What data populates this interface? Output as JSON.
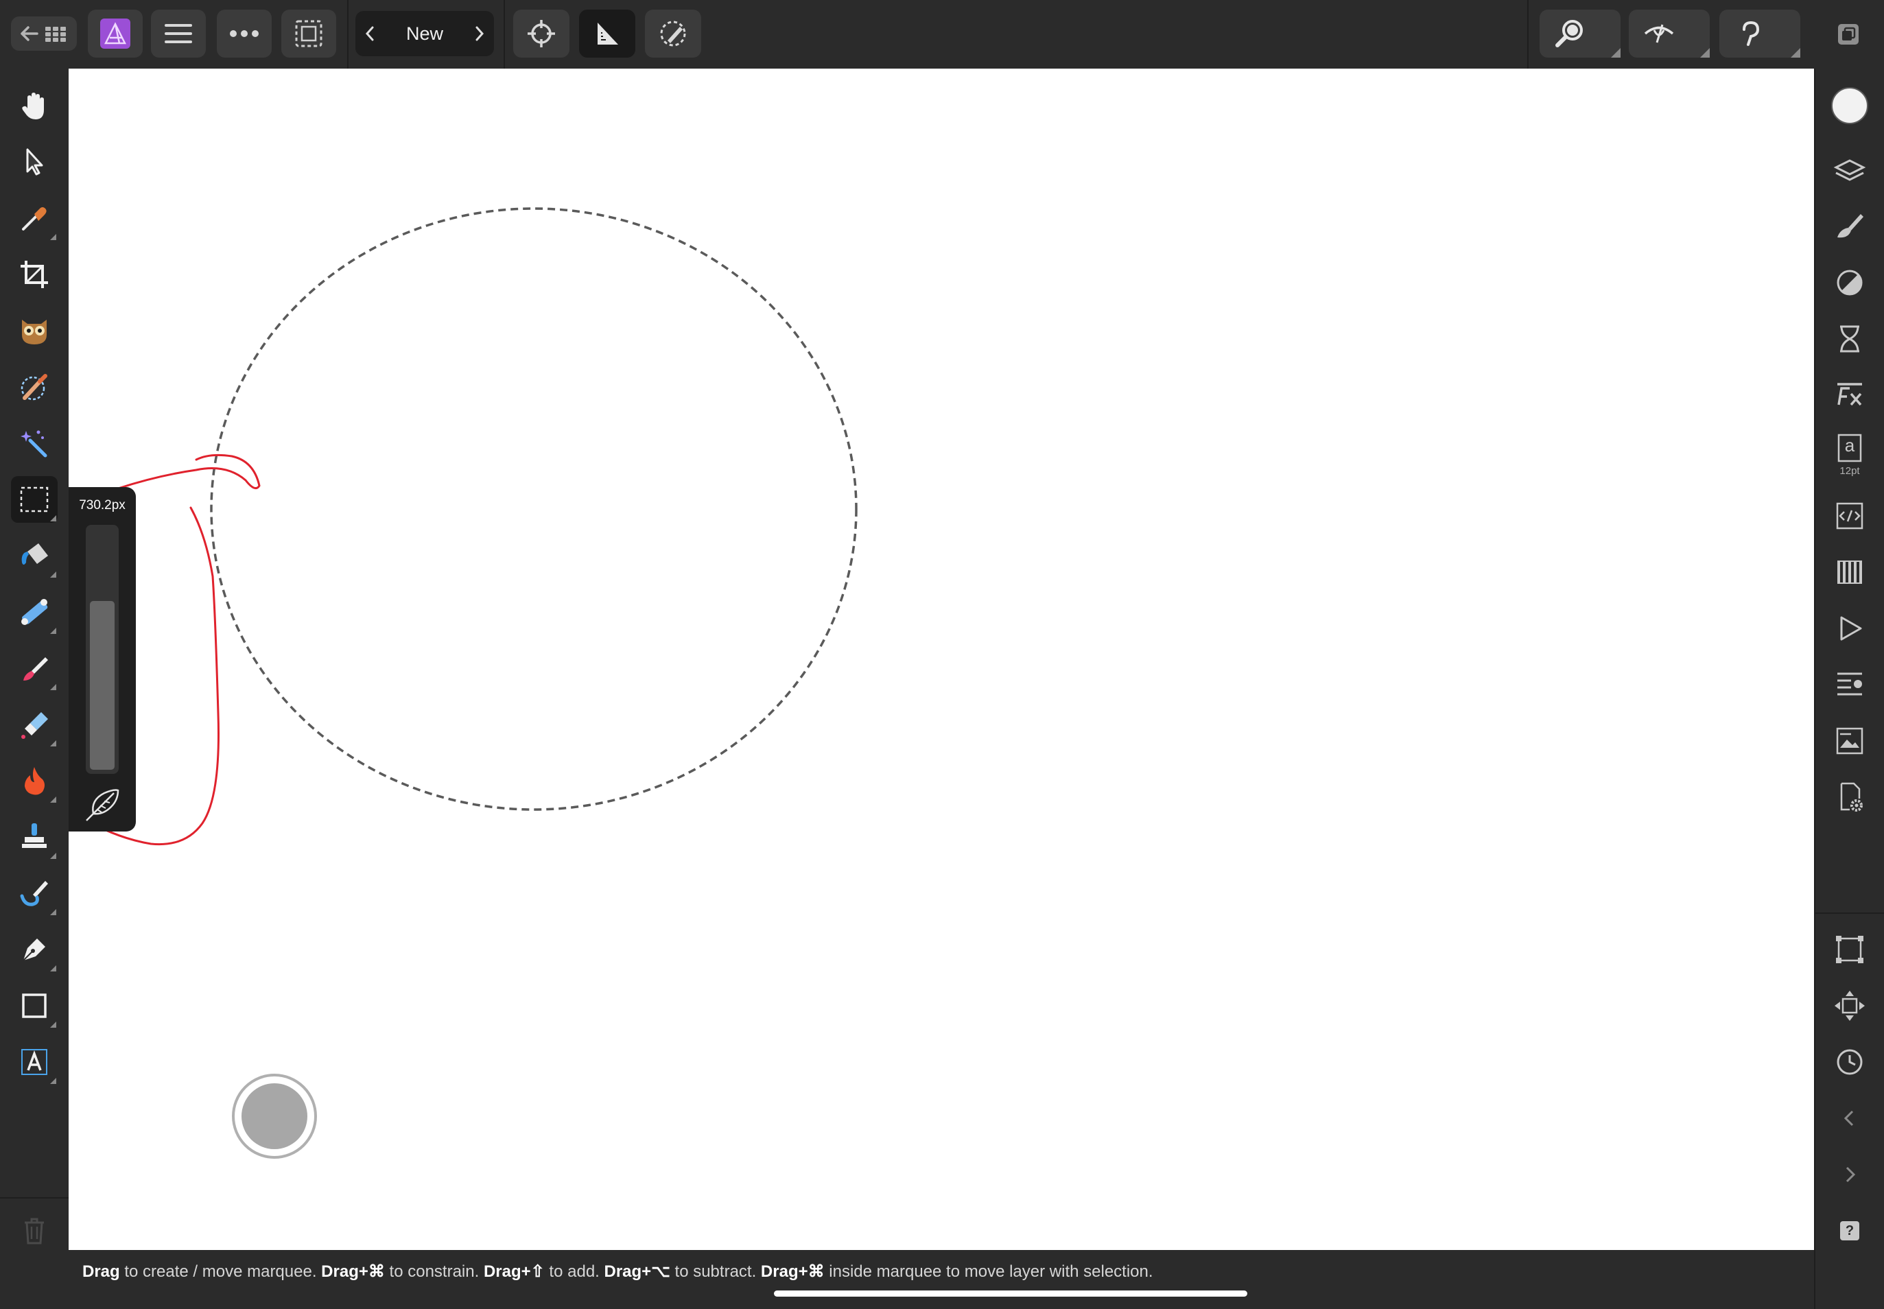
{
  "app": {
    "name": "Affinity Photo"
  },
  "toolbar": {
    "document_name": "New",
    "buttons": [
      {
        "name": "back-to-documents-button",
        "icon": "back-grid-icon"
      },
      {
        "name": "persona-button",
        "icon": "affinity-photo-logo-icon"
      },
      {
        "name": "document-menu-button",
        "icon": "hamburger-icon"
      },
      {
        "name": "more-menu-button",
        "icon": "ellipsis-icon"
      },
      {
        "name": "selection-mode-button",
        "icon": "dashed-selection-icon"
      },
      {
        "name": "snapping-button",
        "icon": "crosshair-icon"
      },
      {
        "name": "levels-button",
        "icon": "ruler-triangle-icon"
      },
      {
        "name": "quick-mask-button",
        "icon": "mask-brush-icon"
      },
      {
        "name": "zoom-button",
        "icon": "magnifier-icon"
      },
      {
        "name": "view-mode-button",
        "icon": "eye-icon"
      },
      {
        "name": "undo-redo-button",
        "icon": "undo-icon"
      },
      {
        "name": "fullscreen-button",
        "icon": "window-icon"
      }
    ]
  },
  "tools": [
    {
      "name": "view-tool",
      "icon": "hand-icon",
      "active": false
    },
    {
      "name": "move-tool",
      "icon": "pointer-arrow-icon",
      "active": false
    },
    {
      "name": "color-picker-tool",
      "icon": "eyedropper-icon",
      "active": false
    },
    {
      "name": "crop-tool",
      "icon": "crop-icon",
      "active": false
    },
    {
      "name": "red-eye-tool",
      "icon": "owl-icon",
      "active": false
    },
    {
      "name": "selection-brush-tool",
      "icon": "selection-brush-icon",
      "active": false
    },
    {
      "name": "magic-wand-tool",
      "icon": "magic-wand-icon",
      "active": false
    },
    {
      "name": "marquee-tool",
      "icon": "dashed-rectangle-icon",
      "active": true
    },
    {
      "name": "flood-fill-tool",
      "icon": "paint-bucket-icon",
      "active": false
    },
    {
      "name": "gradient-tool",
      "icon": "gradient-icon",
      "active": false
    },
    {
      "name": "paint-brush-tool",
      "icon": "paintbrush-icon",
      "active": false
    },
    {
      "name": "erase-brush-tool",
      "icon": "eraser-icon",
      "active": false
    },
    {
      "name": "burn-tool",
      "icon": "flame-icon",
      "active": false
    },
    {
      "name": "clone-tool",
      "icon": "stamp-icon",
      "active": false
    },
    {
      "name": "smudge-tool",
      "icon": "smudge-brush-icon",
      "active": false
    },
    {
      "name": "pen-tool",
      "icon": "pen-nib-icon",
      "active": false
    },
    {
      "name": "rectangle-tool",
      "icon": "square-icon",
      "active": false
    },
    {
      "name": "artistic-text-tool",
      "icon": "text-frame-icon",
      "active": false
    },
    {
      "name": "delete-button",
      "icon": "trash-icon",
      "active": false
    }
  ],
  "studio": {
    "text_size_label": "12pt",
    "text_glyph": "a",
    "question_glyph": "?",
    "items": [
      {
        "name": "color-well",
        "icon": "color-circle-icon"
      },
      {
        "name": "layers-panel-button",
        "icon": "layers-icon"
      },
      {
        "name": "brushes-panel-button",
        "icon": "brush-icon"
      },
      {
        "name": "adjustments-panel-button",
        "icon": "adjustment-circle-icon"
      },
      {
        "name": "history-panel-button",
        "icon": "hourglass-icon"
      },
      {
        "name": "fx-panel-button",
        "icon": "fx-icon"
      },
      {
        "name": "text-styles-button",
        "icon": "text-size-icon"
      },
      {
        "name": "snippets-panel-button",
        "icon": "code-icon"
      },
      {
        "name": "channels-panel-button",
        "icon": "channels-icon"
      },
      {
        "name": "macros-panel-button",
        "icon": "play-icon"
      },
      {
        "name": "styles-panel-button",
        "icon": "styles-icon"
      },
      {
        "name": "stock-panel-button",
        "icon": "image-stack-icon"
      },
      {
        "name": "document-settings-button",
        "icon": "document-gear-icon"
      },
      {
        "name": "transform-panel-button",
        "icon": "transform-box-icon"
      },
      {
        "name": "navigator-button",
        "icon": "move-arrows-icon"
      },
      {
        "name": "history-clock-button",
        "icon": "clock-icon"
      },
      {
        "name": "previous-button",
        "icon": "chevron-left-icon"
      },
      {
        "name": "next-button",
        "icon": "chevron-right-icon"
      },
      {
        "name": "help-button",
        "icon": "help-icon"
      }
    ]
  },
  "feather": {
    "value": "730.2px",
    "level": 0.7
  },
  "status": {
    "segments": [
      {
        "bold": "Drag",
        "text": " to create / move marquee. "
      },
      {
        "bold": "Drag+⌘",
        "text": " to constrain. "
      },
      {
        "bold": "Drag+⇧",
        "text": " to add. "
      },
      {
        "bold": "Drag+⌥",
        "text": " to subtract. "
      },
      {
        "bold": "Drag+⌘",
        "text": " inside marquee to move layer with selection."
      }
    ]
  },
  "colors": {
    "accent_persona": "#9b4fd6",
    "annotation_red": "#e0222d",
    "ui_dark": "#2b2b2b",
    "canvas": "#ffffff"
  }
}
